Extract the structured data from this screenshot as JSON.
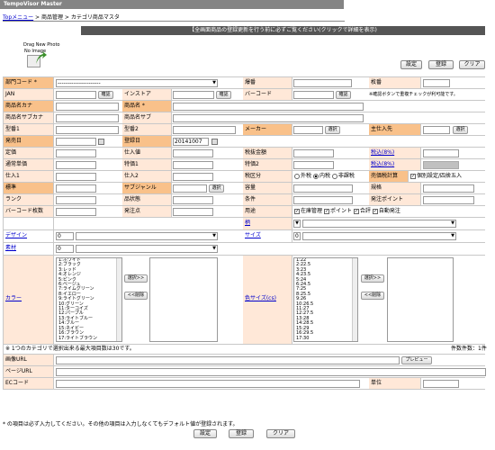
{
  "app_title": "TempoVisor Master",
  "breadcrumb": {
    "top": "Topメニュー",
    "sep1": " > ",
    "mid": "商品管理",
    "sep2": " > ",
    "current": "カテゴリ商品マスタ"
  },
  "notice": "【全画面商品の登録更新を行う前に必ずご覧ください(クリックで詳細を表示)",
  "photo": {
    "drop_label": "Drag New Photo",
    "noimage_label": "No Image"
  },
  "toolbar": {
    "setting": "設定",
    "register": "登録",
    "clear": "クリア"
  },
  "labels": {
    "dept": "部門コード *",
    "dept_value": "----------------------",
    "shiyo": "爆番",
    "sakuban": "枚番",
    "jan": "JAN",
    "confirm": "確認",
    "instore": "インストア",
    "barcode": "バーコード",
    "hint": "※確認ボタンで重複チェックが利可能です。",
    "kana": "商品名カナ",
    "name": "商品名 *",
    "subkana": "商品名サブカナ",
    "subname": "商品名サブ",
    "model1": "型番1",
    "model2": "型番2",
    "maker": "メーカー",
    "select": "選択",
    "supplier": "主仕入先",
    "release": "発売日",
    "regdate": "登録日",
    "regdate_value": "20141007",
    "price": "定価",
    "cost": "仕入値",
    "taxfree": "税抜金額",
    "tax8": "税込(8%)",
    "normalprice": "通常単価",
    "special1": "特価1",
    "special2": "特価2",
    "tax8b": "税込(8%)",
    "shiire1": "仕入1",
    "shiire2": "仕入2",
    "taxtype": "税区分",
    "tax_out": "外税",
    "tax_in": "内税",
    "tax_none": "非課税",
    "salestax": "売価税計算",
    "pointset": "個別設定/四捨五入",
    "size": "標準",
    "subgenre": "サブジャンル",
    "capacity": "容量",
    "unit": "規格",
    "rank": "ランク",
    "type": "品状態",
    "condition": "条件",
    "orderpoint": "発注ポイント",
    "barcode_count": "バーコード枚数",
    "order_unit": "発注点",
    "usage": "用途",
    "chk_stock": "在庫管理",
    "chk_point": "ポイント",
    "chk_pass": "合評",
    "chk_auto": "自動発注",
    "pattern": "柄",
    "design": "デザイン",
    "design_value": "0",
    "sizelabel": "サイズ",
    "size_value": "0",
    "material": "素材",
    "material_value": "0",
    "color": "カラー",
    "colorsize": "色サイズ(cs)",
    "add": "選択>>",
    "remove": "<<削除",
    "maxnote": "※ 1つのカテゴリで選択出来る最大項目数は30です。",
    "count": "件数件数：1件",
    "imgurl": "画像URL",
    "preview": "プレビュー",
    "pageurl": "ページURL",
    "ecode": "ECコード",
    "unitlabel": "単位",
    "footnote": "* の項目は必ず入力してください。その他の項目は入力しなくてもデフォルト値が登録されます。"
  },
  "colors_list": [
    "1:ホワイト",
    "2:ブラック",
    "3:レッド",
    "4:オレンジ",
    "5:ピンク",
    "6:ベージュ",
    "7:ライムグリーン",
    "8:イエロー",
    "9:ライトグリーン",
    "10:グリーン",
    "11:ターコイズ",
    "12:パープル",
    "13:ライトブルー",
    "14:ブルー",
    "15:ネイビー",
    "16:ブラウン",
    "17:ライトブラウン"
  ],
  "sizes_list": [
    "1:22",
    "2:22.5",
    "3:23",
    "4:23.5",
    "5:24",
    "6:24.5",
    "7:25",
    "8:25.5",
    "9:26",
    "10:26.5",
    "11:27",
    "12:27.5",
    "13:28",
    "14:28.5",
    "15:29",
    "16:29.5",
    "17:30"
  ],
  "bottom": {
    "setting": "設定",
    "register": "登録",
    "clear": "クリア"
  }
}
